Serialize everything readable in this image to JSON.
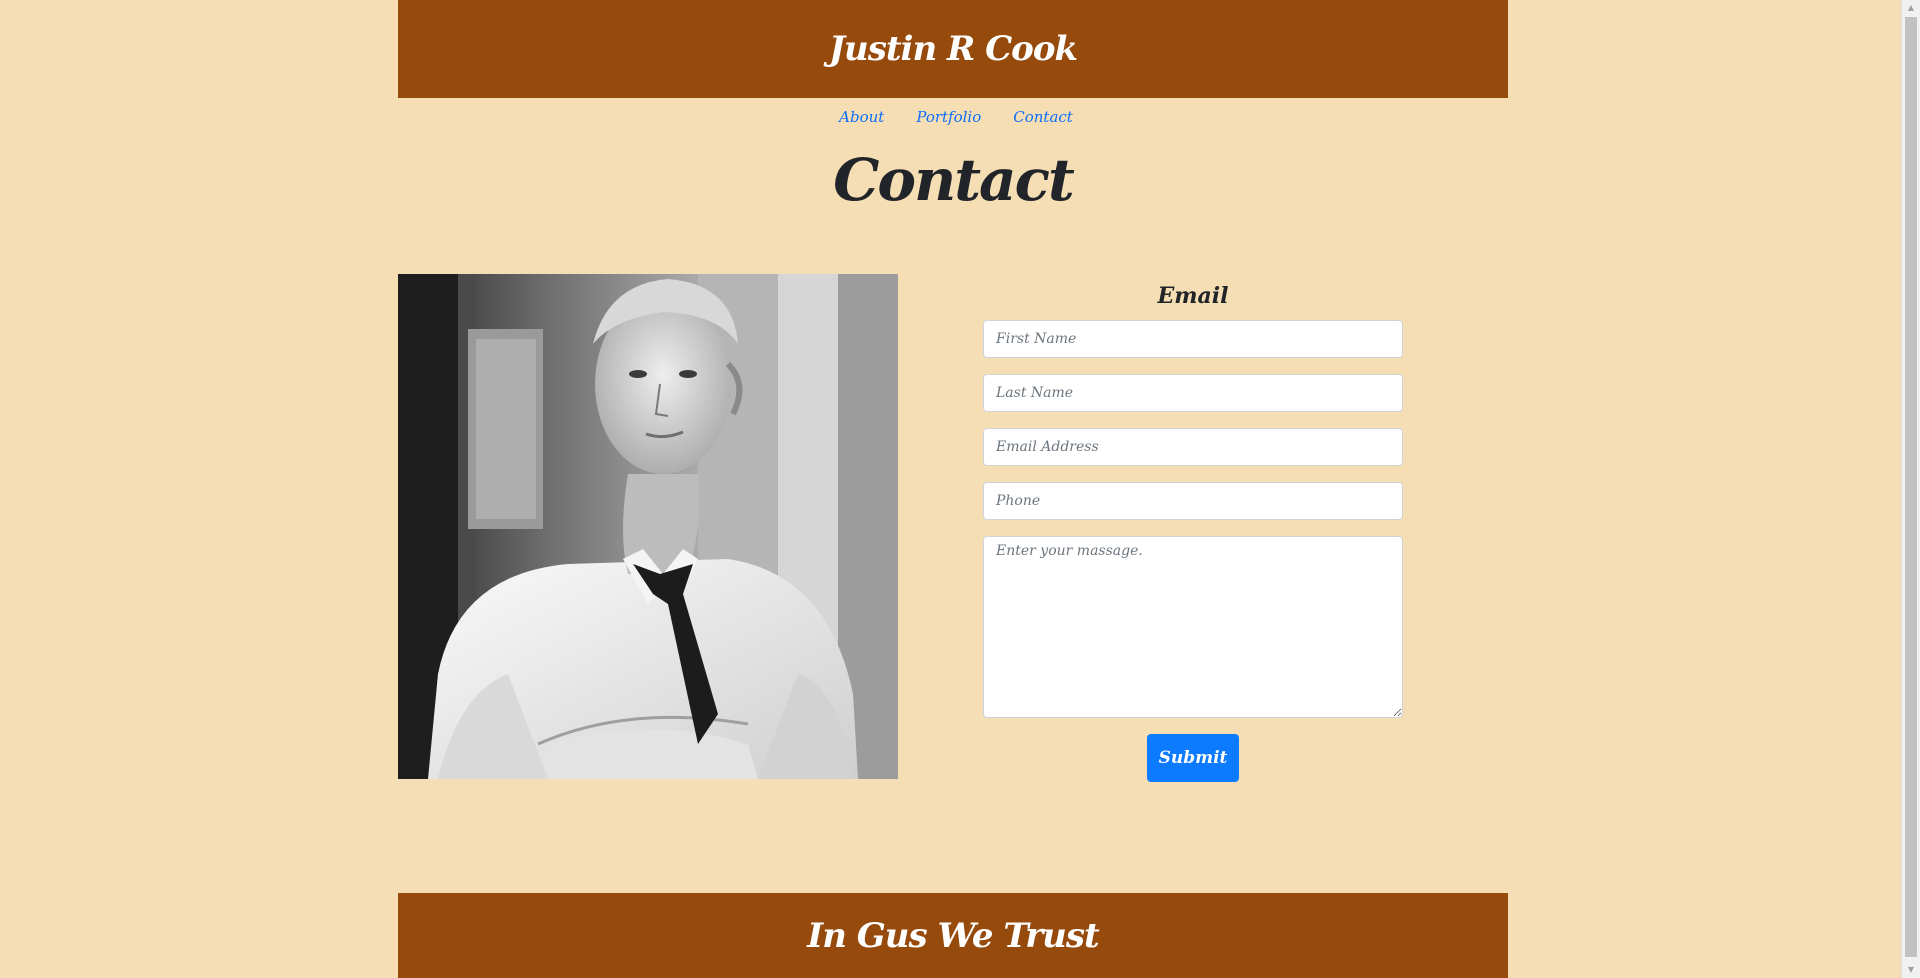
{
  "header": {
    "title": "Justin R Cook"
  },
  "nav": {
    "items": [
      {
        "label": "About"
      },
      {
        "label": "Portfolio"
      },
      {
        "label": "Contact"
      }
    ]
  },
  "page": {
    "title": "Contact"
  },
  "photo": {
    "alt": "Black and white portrait of a man in a white shirt and dark tie with arms crossed"
  },
  "form": {
    "title": "Email",
    "first_name_placeholder": "First Name",
    "last_name_placeholder": "Last Name",
    "email_placeholder": "Email Address",
    "phone_placeholder": "Phone",
    "message_placeholder": "Enter your massage.",
    "submit_label": "Submit"
  },
  "footer": {
    "text": "In Gus We Trust"
  },
  "colors": {
    "background": "#f5deb3",
    "banner": "#964a0b",
    "link": "#0d6efd",
    "button": "#0d7bff"
  },
  "icons": {
    "scroll_up": "scroll-up-arrow-icon",
    "scroll_down": "scroll-down-arrow-icon"
  }
}
